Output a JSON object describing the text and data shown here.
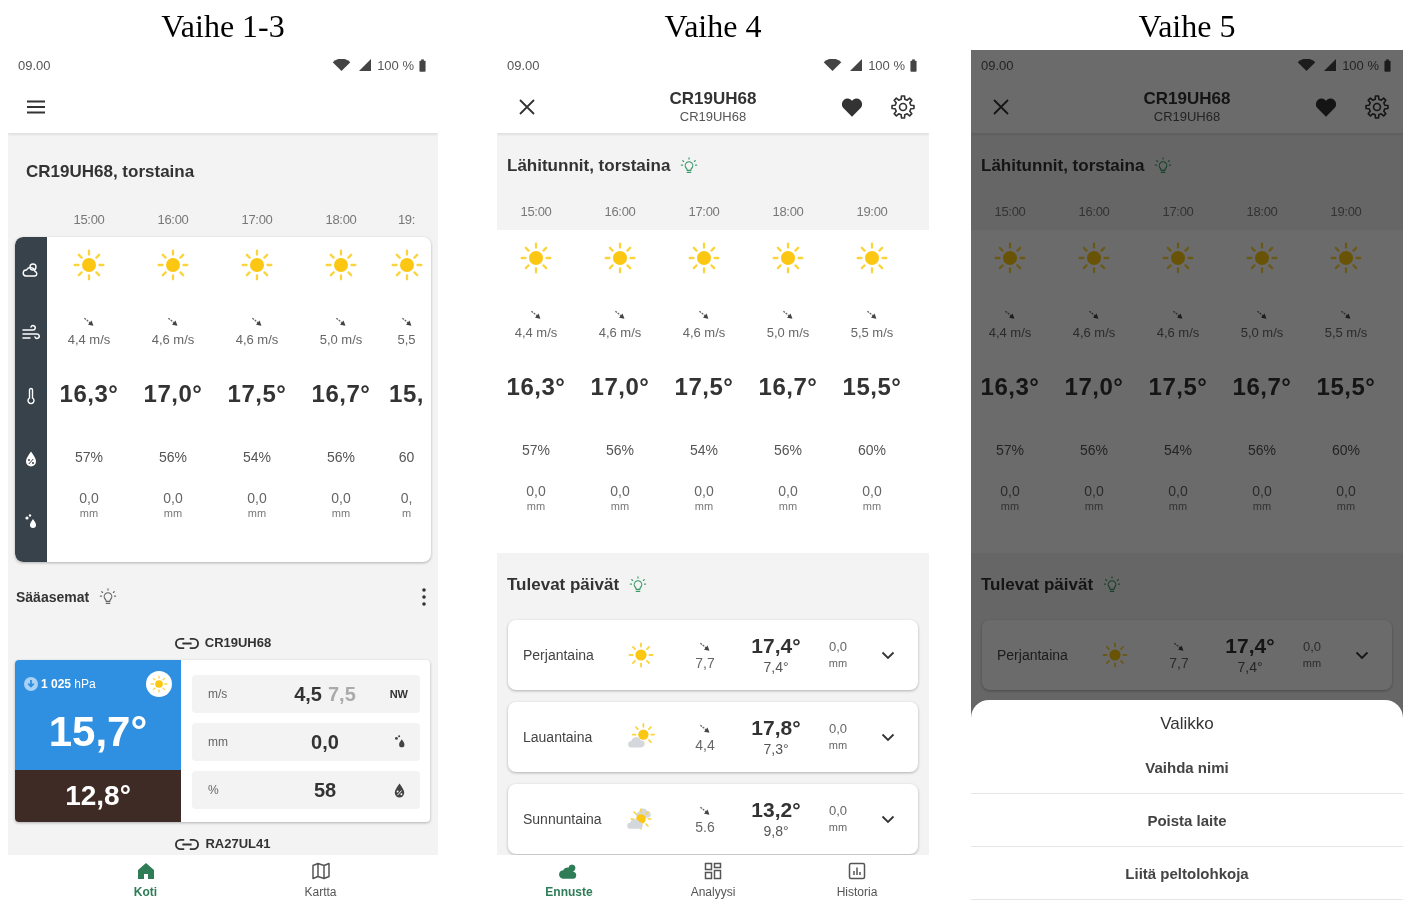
{
  "panels": [
    {
      "kind": "home",
      "caption": "Vaihe 1-3",
      "dimmed": false,
      "status": {
        "time": "09.00",
        "battery": "100 %"
      },
      "title": "CR19UH68, torstaina",
      "hourly": [
        {
          "kind": "sunny",
          "time": "15:00",
          "wind": "4,4 m/s",
          "temp": "16,3°",
          "humidity": "57%",
          "rain": "0,0",
          "rain_unit": "mm"
        },
        {
          "kind": "sunny",
          "time": "16:00",
          "wind": "4,6 m/s",
          "temp": "17,0°",
          "humidity": "56%",
          "rain": "0,0",
          "rain_unit": "mm"
        },
        {
          "kind": "sunny",
          "time": "17:00",
          "wind": "4,6 m/s",
          "temp": "17,5°",
          "humidity": "54%",
          "rain": "0,0",
          "rain_unit": "mm"
        },
        {
          "kind": "sunny",
          "time": "18:00",
          "wind": "5,0 m/s",
          "temp": "16,7°",
          "humidity": "56%",
          "rain": "0,0",
          "rain_unit": "mm"
        },
        {
          "kind": "sunny",
          "time": "19:",
          "wind": "5,5",
          "temp": "15,",
          "humidity": "60",
          "rain": "0,",
          "rain_unit": "m"
        }
      ],
      "stations_title": "Sääasemat",
      "stations": [
        {
          "name": "CR19UH68",
          "badge": {
            "kind": "sunny"
          },
          "pressure": "**1 025** hPa",
          "temperature": "15,7°",
          "ground_temperature": "12,8°",
          "readings": [
            {
              "kind": "wind",
              "unit": "m/s",
              "value": "4,5",
              "gust": "7,5",
              "direction": "NW"
            },
            {
              "kind": "rain",
              "unit": "mm",
              "value": "0,0"
            },
            {
              "kind": "humidity",
              "unit": "%",
              "value": "58"
            }
          ]
        },
        {
          "name": "RA27UL41"
        }
      ],
      "nav": [
        {
          "kind": "home",
          "label": "Koti",
          "selected": true
        },
        {
          "kind": "map",
          "label": "Kartta",
          "selected": false
        }
      ]
    },
    {
      "kind": "device",
      "caption": "Vaihe 4",
      "dimmed": false,
      "status": {
        "time": "09.00",
        "battery": "100 %"
      },
      "header": {
        "title": "CR19UH68",
        "subtitle": "CR19UH68",
        "favorite": true
      },
      "hourly_title": "Lähitunnit, torstaina",
      "hourly": [
        {
          "kind": "sunny",
          "time": "15:00",
          "wind": "4,4 m/s",
          "temp": "16,3°",
          "humidity": "57%",
          "rain": "0,0",
          "rain_unit": "mm"
        },
        {
          "kind": "sunny",
          "time": "16:00",
          "wind": "4,6 m/s",
          "temp": "17,0°",
          "humidity": "56%",
          "rain": "0,0",
          "rain_unit": "mm"
        },
        {
          "kind": "sunny",
          "time": "17:00",
          "wind": "4,6 m/s",
          "temp": "17,5°",
          "humidity": "54%",
          "rain": "0,0",
          "rain_unit": "mm"
        },
        {
          "kind": "sunny",
          "time": "18:00",
          "wind": "5,0 m/s",
          "temp": "16,7°",
          "humidity": "56%",
          "rain": "0,0",
          "rain_unit": "mm"
        },
        {
          "kind": "sunny",
          "time": "19:00",
          "wind": "5,5 m/s",
          "temp": "15,5°",
          "humidity": "60%",
          "rain": "0,0",
          "rain_unit": "mm"
        }
      ],
      "days_title": "Tulevat päivät",
      "days": [
        {
          "kind": "sunny",
          "day": "Perjantaina",
          "wind": "7,7",
          "high": "17,4°",
          "low": "7,4°",
          "rain": "0,0",
          "rain_unit": "mm",
          "expanded": false
        },
        {
          "kind": "partly_cloudy",
          "day": "Lauantaina",
          "wind": "4,4",
          "high": "17,8°",
          "low": "7,3°",
          "rain": "0,0",
          "rain_unit": "mm",
          "expanded": false
        },
        {
          "kind": "cloudy_sun",
          "day": "Sunnuntaina",
          "wind": "5.6",
          "high": "13,2°",
          "low": "9,8°",
          "rain": "0,0",
          "rain_unit": "mm",
          "expanded": false
        }
      ],
      "nav": [
        {
          "kind": "forecast",
          "label": "Ennuste",
          "selected": true
        },
        {
          "kind": "analysis",
          "label": "Analyysi",
          "selected": false
        },
        {
          "kind": "history",
          "label": "Historia",
          "selected": false
        }
      ]
    },
    {
      "kind": "device",
      "caption": "Vaihe 5",
      "dimmed": true,
      "status": {
        "time": "09.00",
        "battery": "100 %"
      },
      "header": {
        "title": "CR19UH68",
        "subtitle": "CR19UH68",
        "favorite": true
      },
      "hourly_title": "Lähitunnit, torstaina",
      "hourly": [
        {
          "kind": "sunny",
          "time": "15:00",
          "wind": "4,4 m/s",
          "temp": "16,3°",
          "humidity": "57%",
          "rain": "0,0",
          "rain_unit": "mm"
        },
        {
          "kind": "sunny",
          "time": "16:00",
          "wind": "4,6 m/s",
          "temp": "17,0°",
          "humidity": "56%",
          "rain": "0,0",
          "rain_unit": "mm"
        },
        {
          "kind": "sunny",
          "time": "17:00",
          "wind": "4,6 m/s",
          "temp": "17,5°",
          "humidity": "54%",
          "rain": "0,0",
          "rain_unit": "mm"
        },
        {
          "kind": "sunny",
          "time": "18:00",
          "wind": "5,0 m/s",
          "temp": "16,7°",
          "humidity": "56%",
          "rain": "0,0",
          "rain_unit": "mm"
        },
        {
          "kind": "sunny",
          "time": "19:00",
          "wind": "5,5 m/s",
          "temp": "15,5°",
          "humidity": "60%",
          "rain": "0,0",
          "rain_unit": "mm"
        }
      ],
      "days_title": "Tulevat päivät",
      "days": [
        {
          "kind": "sunny",
          "day": "Perjantaina",
          "wind": "7,7",
          "high": "17,4°",
          "low": "7,4°",
          "rain": "0,0",
          "rain_unit": "mm",
          "expanded": false
        }
      ],
      "menu": {
        "title": "Valikko",
        "items": [
          "Vaihda nimi",
          "Poista laite",
          "Liitä peltolohkoja"
        ]
      }
    }
  ]
}
